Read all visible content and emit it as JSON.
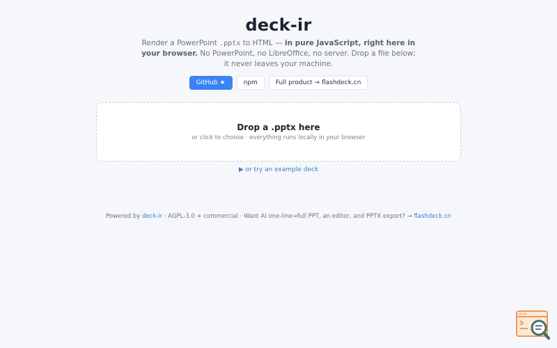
{
  "header": {
    "title": "deck-ir"
  },
  "lead": {
    "part1": "Render a PowerPoint ",
    "code": ".pptx",
    "part2": " to HTML — ",
    "bold": "in pure JavaScript, right here in your browser.",
    "part3": " No PowerPoint, no LibreOffice, no server. Drop a file below; it never leaves your machine."
  },
  "buttons": {
    "github": "GitHub ★",
    "npm": "npm",
    "full_product": "Full product → flashdeck.cn"
  },
  "dropzone": {
    "title": "Drop a .pptx here",
    "subtitle": "or click to choose · everything runs locally in your browser"
  },
  "example_link": "▶ or try an example deck",
  "footer": {
    "prefix": "Powered by ",
    "link1": "deck-ir",
    "middle": " · AGPL-3.0 + commercial · Want AI one-line→full PPT, an editor, and PPTX export? → ",
    "link2": "flashdeck.cn"
  },
  "colors": {
    "background": "#f6f7fb",
    "accent": "#3b82f6",
    "link": "#3a7bd5"
  },
  "icons": {
    "corner": "search-window-icon"
  }
}
